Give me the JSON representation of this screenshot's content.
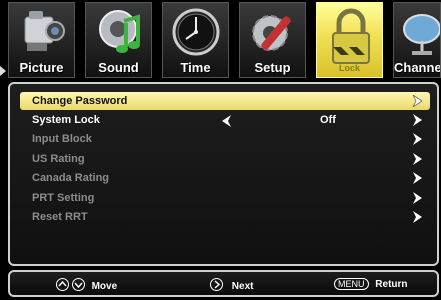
{
  "tabs": [
    {
      "label": "Picture",
      "icon": "camcorder-icon"
    },
    {
      "label": "Sound",
      "icon": "music-note-icon"
    },
    {
      "label": "Time",
      "icon": "clock-icon"
    },
    {
      "label": "Setup",
      "icon": "gear-wrench-icon"
    },
    {
      "label": "Lock",
      "icon": "padlock-icon"
    },
    {
      "label": "Channel",
      "icon": "satellite-dish-icon"
    }
  ],
  "active_tab": "Lock",
  "menu": {
    "items": [
      {
        "label": "Change Password",
        "value": "",
        "state": "selected"
      },
      {
        "label": "System Lock",
        "value": "Off",
        "state": "enabled"
      },
      {
        "label": "Input Block",
        "value": "",
        "state": "disabled"
      },
      {
        "label": "US Rating",
        "value": "",
        "state": "disabled"
      },
      {
        "label": "Canada Rating",
        "value": "",
        "state": "disabled"
      },
      {
        "label": "PRT Setting",
        "value": "",
        "state": "disabled"
      },
      {
        "label": "Reset RRT",
        "value": "",
        "state": "disabled"
      }
    ]
  },
  "footer": {
    "move": "Move",
    "next": "Next",
    "menu_key": "MENU",
    "return": "Return"
  },
  "colors": {
    "highlight": "#f3e35a",
    "disabled_text": "#8c8c8c"
  }
}
